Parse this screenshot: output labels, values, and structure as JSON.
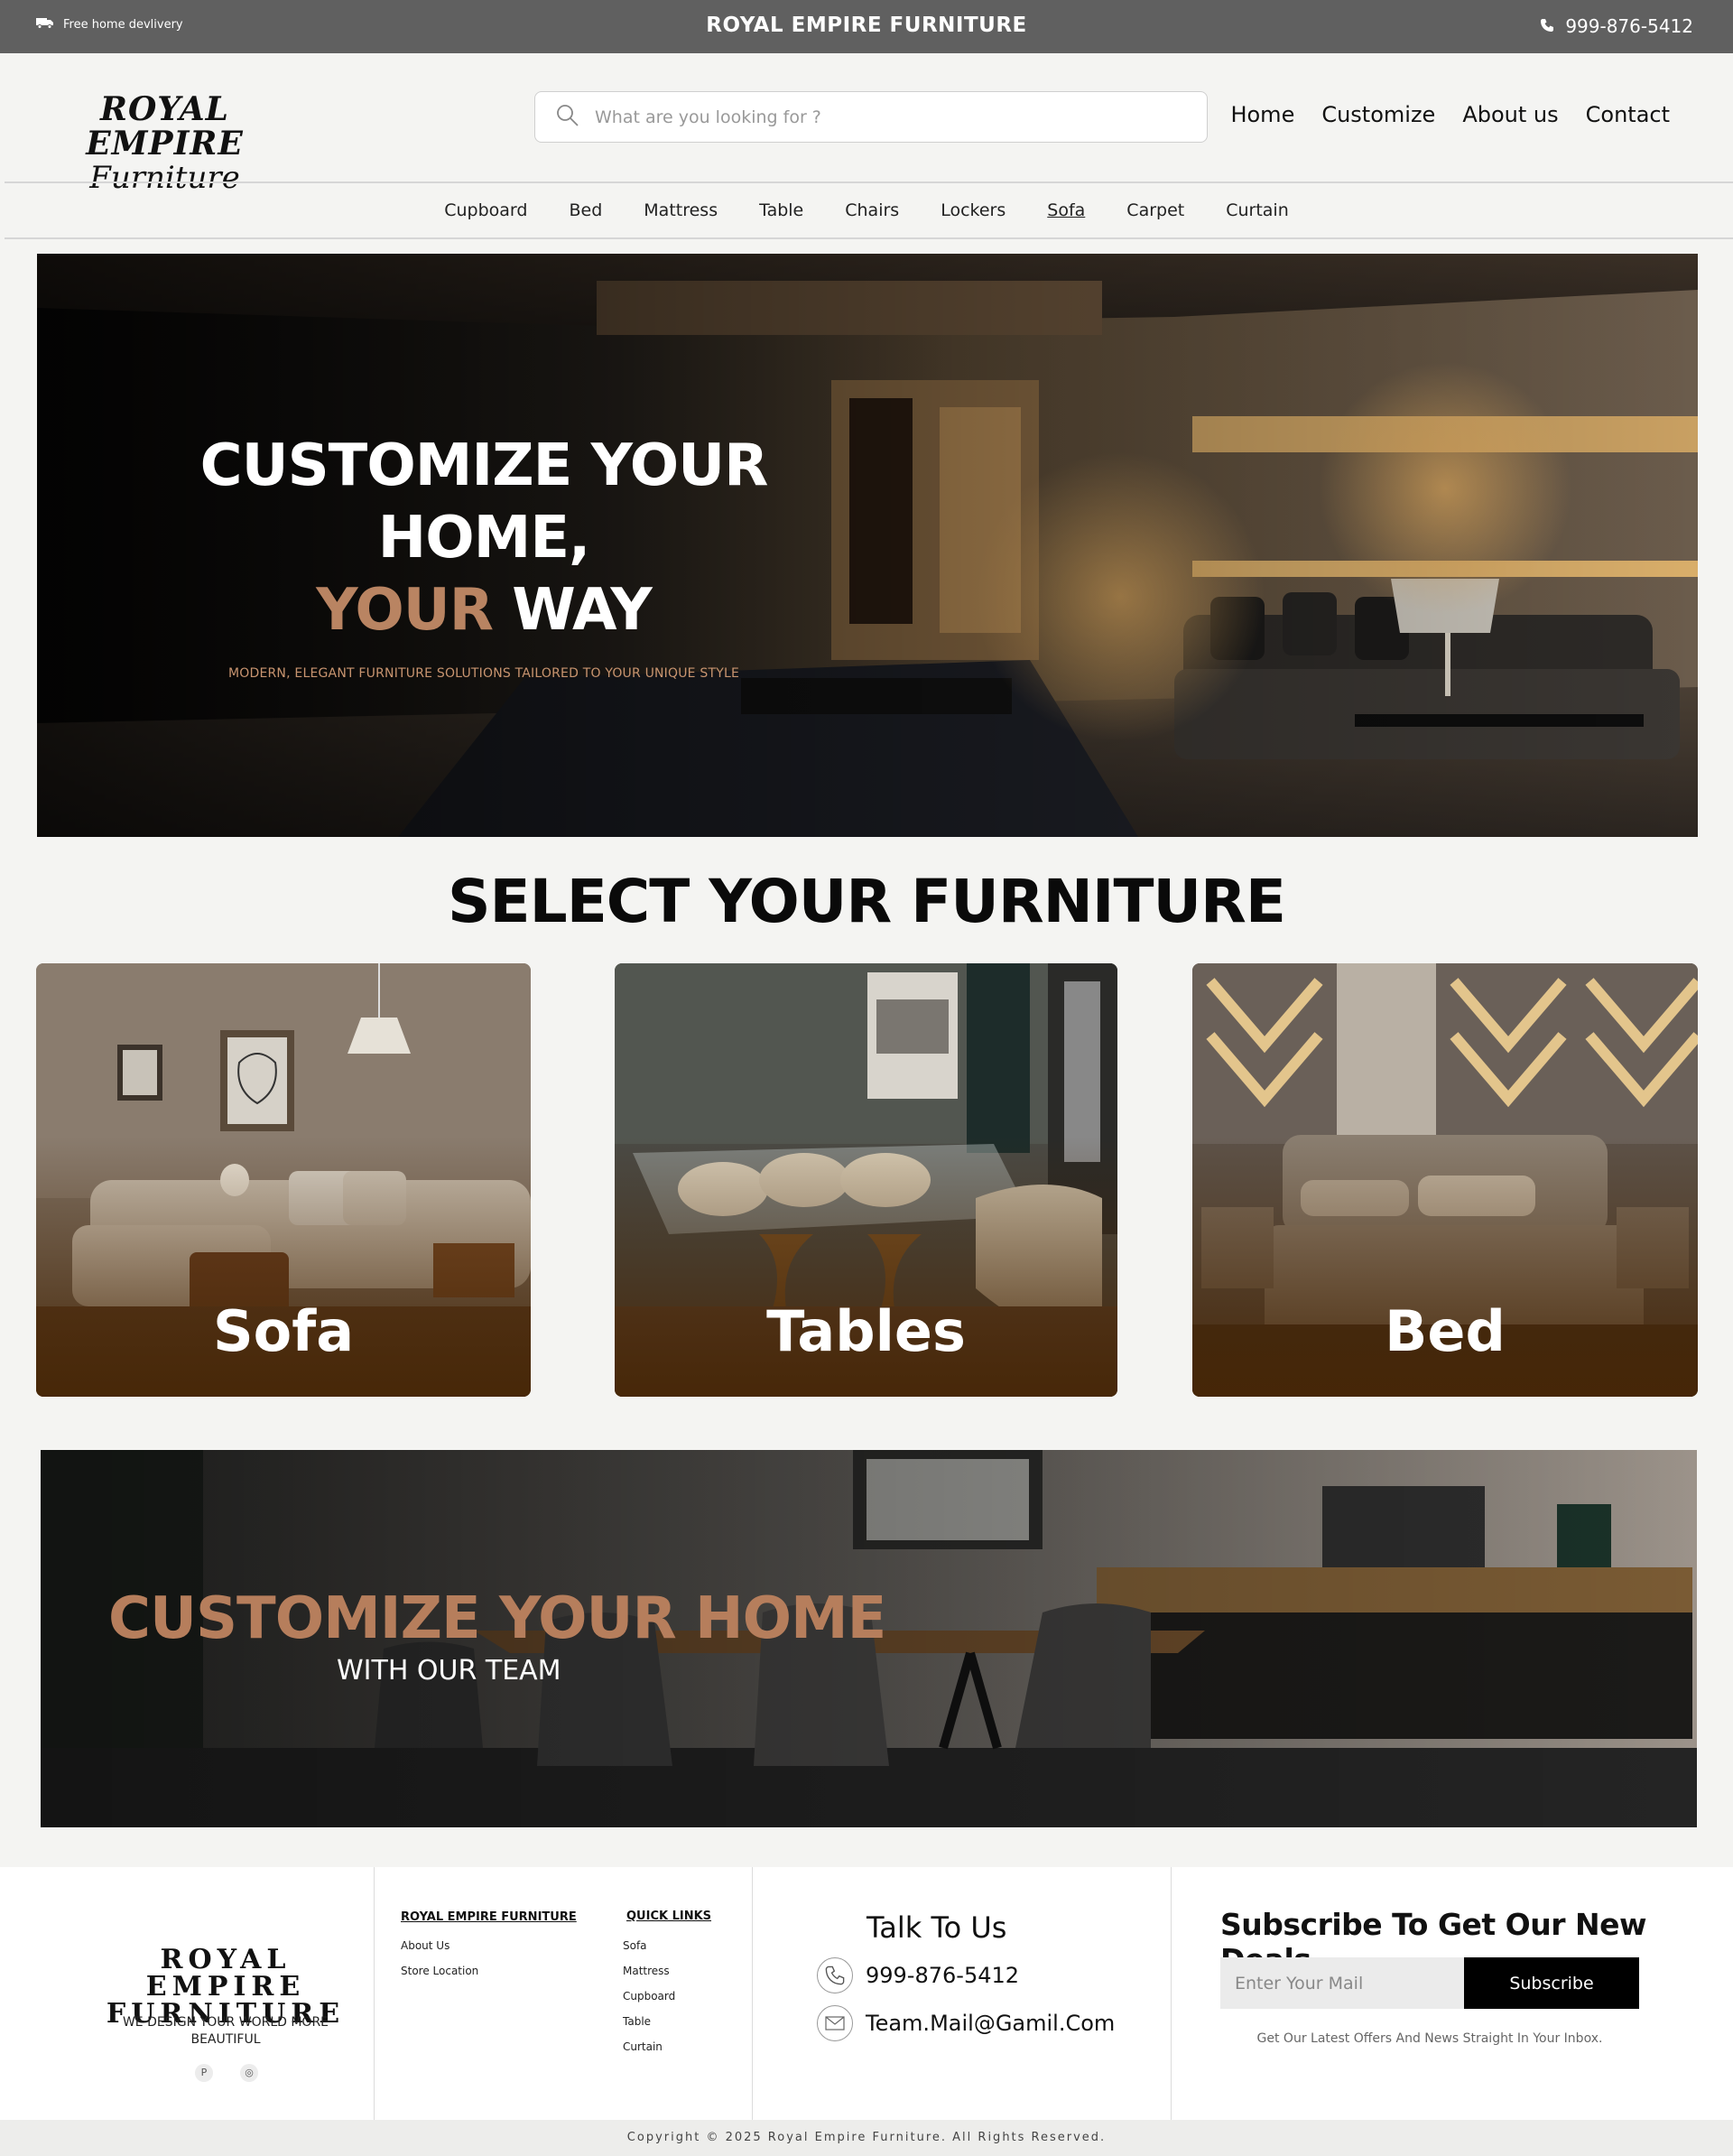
{
  "topbar": {
    "delivery": "Free home devlivery",
    "brand": "ROYAL EMPIRE  FURNITURE",
    "phone": "999-876-5412",
    "icons": [
      "truck-icon",
      "phone-icon"
    ]
  },
  "header": {
    "logo_line1": "ROYAL EMPIRE",
    "logo_line2": "Furniture",
    "search_placeholder": "What are you looking for ?",
    "nav": [
      "Home",
      "Customize",
      "About us",
      "Contact"
    ]
  },
  "categories": {
    "items": [
      "Cupboard",
      "Bed",
      "Mattress",
      "Table",
      "Chairs",
      "Lockers",
      "Sofa",
      "Carpet",
      "Curtain"
    ],
    "active": "Sofa"
  },
  "hero": {
    "line1": "CUSTOMIZE YOUR HOME,",
    "line2_accent": "YOUR",
    "line2_rest": "WAY",
    "subtitle": "MODERN, ELEGANT FURNITURE SOLUTIONS TAILORED TO YOUR UNIQUE STYLE",
    "accent_color": "#b98462"
  },
  "select_section": {
    "title": "SELECT YOUR FURNITURE",
    "cards": [
      "Sofa",
      "Tables",
      "Bed"
    ]
  },
  "banner": {
    "title": "CUSTOMIZE YOUR HOME",
    "subtitle": "WITH OUR TEAM"
  },
  "footer": {
    "logo_line1": "ROYAL EMPIRE",
    "logo_line2": "FURNITURE",
    "tagline": "WE DESIGN YOUR WORLD MORE BEAUTIFUL",
    "col1_heading": "ROYAL EMPIRE FURNITURE",
    "col1_links": [
      "About Us",
      "Store Location"
    ],
    "col2_heading": "QUICK LINKS",
    "col2_links": [
      "Sofa",
      "Mattress",
      "Cupboard",
      "Table",
      "Curtain"
    ],
    "talk_title": "Talk To Us",
    "phone": "999-876-5412",
    "email": "Team.Mail@Gamil.Com",
    "subscribe_title": "Subscribe To Get Our New Deals",
    "subscribe_placeholder": "Enter Your Mail",
    "subscribe_button": "Subscribe",
    "subscribe_note": "Get Our Latest Offers And News Straight In Your Inbox.",
    "copyright": "Copyright © 2025 Royal Empire Furniture. All Rights Reserved."
  }
}
